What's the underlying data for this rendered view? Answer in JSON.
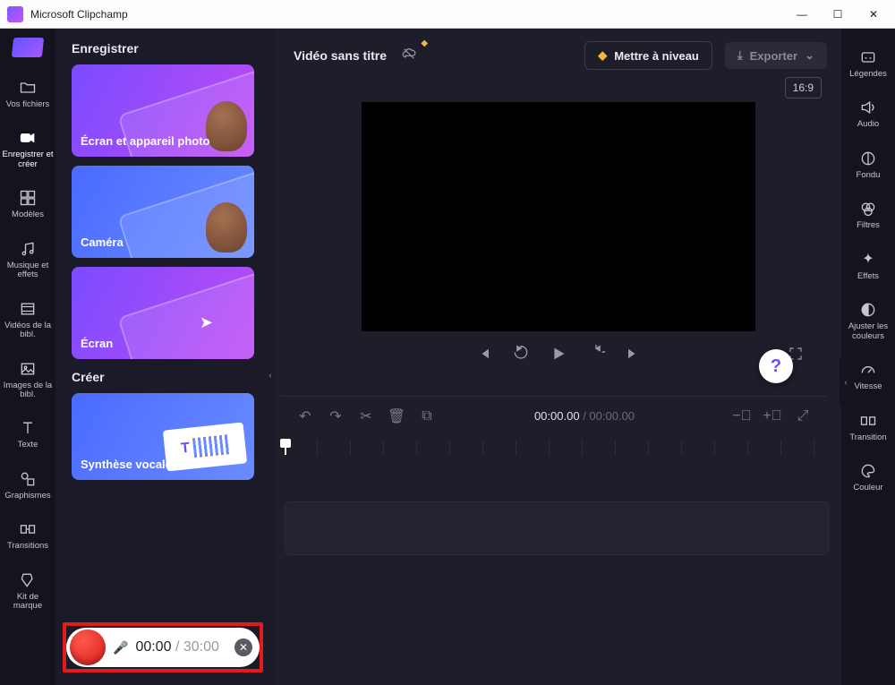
{
  "window": {
    "title": "Microsoft Clipchamp"
  },
  "leftnav": {
    "items": [
      {
        "label": "Vos fichiers"
      },
      {
        "label": "Enregistrer et créer"
      },
      {
        "label": "Modèles"
      },
      {
        "label": "Musique et effets"
      },
      {
        "label": "Vidéos de la bibl."
      },
      {
        "label": "Images de la bibl."
      },
      {
        "label": "Texte"
      },
      {
        "label": "Graphismes"
      },
      {
        "label": "Transitions"
      },
      {
        "label": "Kit de marque"
      }
    ]
  },
  "panel": {
    "record_heading": "Enregistrer",
    "create_heading": "Créer",
    "cards": {
      "screen_camera": "Écran et appareil photo",
      "camera": "Caméra",
      "screen": "Écran",
      "tts": "Synthèse vocale"
    }
  },
  "topbar": {
    "video_title": "Vidéo sans titre",
    "upgrade": "Mettre à niveau",
    "export": "Exporter"
  },
  "preview": {
    "ratio": "16:9"
  },
  "timeline": {
    "current": "00:00.00",
    "total": "00:00.00"
  },
  "rightrail": {
    "items": [
      {
        "label": "Légendes"
      },
      {
        "label": "Audio"
      },
      {
        "label": "Fondu"
      },
      {
        "label": "Filtres"
      },
      {
        "label": "Effets"
      },
      {
        "label": "Ajuster les couleurs"
      },
      {
        "label": "Vitesse"
      },
      {
        "label": "Transition"
      },
      {
        "label": "Couleur"
      }
    ]
  },
  "recorder": {
    "elapsed": "00:00",
    "limit": "30:00"
  }
}
